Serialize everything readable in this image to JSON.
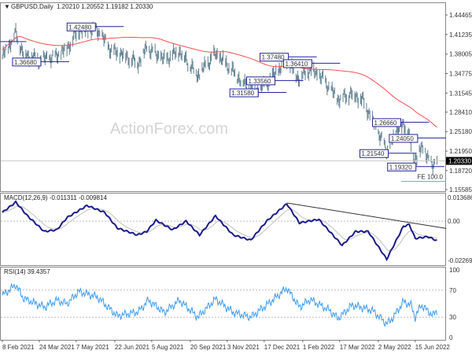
{
  "header": {
    "symbol": "GBPUSD,Daily",
    "ohlc": "1.20210 1.20552 1.19182 1.20330"
  },
  "watermark": "ActionForex.com",
  "colors": {
    "bars": "#5f7f91",
    "ma": "#f05050",
    "macd": "#1a1a8c",
    "signal": "#c0c0c0",
    "rsi": "#3d9bf0",
    "label_border": "#2020a0",
    "current_tag": "#000000"
  },
  "chart_data": [
    {
      "type": "ohlc",
      "title": "GBPUSD,Daily",
      "y_ticks": [
        "1.44465",
        "1.41235",
        "1.38005",
        "1.34775",
        "1.31545",
        "1.28410",
        "1.25180",
        "1.21950",
        "1.18720",
        "1.15585"
      ],
      "ylim": [
        1.15585,
        1.44465
      ],
      "current": "1.20330",
      "current_value": 1.2033,
      "closes": [
        [
          "2021-02-08",
          1.375
        ],
        [
          "2021-02-24",
          1.415
        ],
        [
          "2021-03-05",
          1.38
        ],
        [
          "2021-03-24",
          1.37
        ],
        [
          "2021-04-12",
          1.375
        ],
        [
          "2021-04-26",
          1.39
        ],
        [
          "2021-05-10",
          1.42
        ],
        [
          "2021-06-01",
          1.42
        ],
        [
          "2021-06-18",
          1.385
        ],
        [
          "2021-07-01",
          1.38
        ],
        [
          "2021-07-20",
          1.365
        ],
        [
          "2021-07-30",
          1.39
        ],
        [
          "2021-08-20",
          1.37
        ],
        [
          "2021-09-07",
          1.385
        ],
        [
          "2021-09-29",
          1.345
        ],
        [
          "2021-10-20",
          1.38
        ],
        [
          "2021-11-01",
          1.365
        ],
        [
          "2021-11-24",
          1.33
        ],
        [
          "2021-12-08",
          1.32
        ],
        [
          "2021-12-20",
          1.33
        ],
        [
          "2022-01-13",
          1.37
        ],
        [
          "2022-01-27",
          1.34
        ],
        [
          "2022-02-10",
          1.355
        ],
        [
          "2022-02-24",
          1.34
        ],
        [
          "2022-03-15",
          1.305
        ],
        [
          "2022-03-31",
          1.315
        ],
        [
          "2022-04-13",
          1.305
        ],
        [
          "2022-04-22",
          1.28
        ],
        [
          "2022-05-12",
          1.22
        ],
        [
          "2022-05-27",
          1.262
        ],
        [
          "2022-06-07",
          1.255
        ],
        [
          "2022-06-14",
          1.2
        ],
        [
          "2022-06-20",
          1.225
        ],
        [
          "2022-06-30",
          1.213
        ],
        [
          "2022-07-06",
          1.19
        ],
        [
          "2022-07-11",
          1.2033
        ]
      ],
      "swing_labels": [
        {
          "text": "1.40000",
          "date": "2021-02-01",
          "price": 1.4
        },
        {
          "text": "1.36680",
          "date": "2021-03-24",
          "price": 1.3668
        },
        {
          "text": "1.42480",
          "date": "2021-05-28",
          "price": 1.4248
        },
        {
          "text": "1.31580",
          "date": "2021-12-08",
          "price": 1.3158
        },
        {
          "text": "1.37480",
          "date": "2022-01-13",
          "price": 1.3748
        },
        {
          "text": "1.33560",
          "date": "2021-12-28",
          "price": 1.3356
        },
        {
          "text": "1.36410",
          "date": "2022-02-10",
          "price": 1.3641
        },
        {
          "text": "1.26660",
          "date": "2022-05-27",
          "price": 1.2666
        },
        {
          "text": "1.21540",
          "date": "2022-05-12",
          "price": 1.2154
        },
        {
          "text": "1.24050",
          "date": "2022-06-16",
          "price": 1.2405
        },
        {
          "text": "1.19320",
          "date": "2022-06-14",
          "price": 1.1932
        }
      ],
      "fe_label": "FE 100.0",
      "fe_price": 1.1695
    },
    {
      "type": "line",
      "title": "MACD(12,26,9) -0.011311 -0.009814",
      "y_ticks": [
        "0.013686",
        "0.00",
        "-0.022698"
      ],
      "ylim": [
        -0.022698,
        0.013686
      ],
      "macd": [
        [
          "2021-02-08",
          0.005
        ],
        [
          "2021-02-24",
          0.011
        ],
        [
          "2021-03-10",
          0.003
        ],
        [
          "2021-03-30",
          -0.006
        ],
        [
          "2021-04-14",
          -0.005
        ],
        [
          "2021-04-26",
          0.002
        ],
        [
          "2021-05-20",
          0.009
        ],
        [
          "2021-06-10",
          0.005
        ],
        [
          "2021-06-25",
          -0.004
        ],
        [
          "2021-07-19",
          -0.008
        ],
        [
          "2021-07-30",
          -0.006
        ],
        [
          "2021-08-10",
          0.0005
        ],
        [
          "2021-08-30",
          -0.005
        ],
        [
          "2021-09-15",
          0.0
        ],
        [
          "2021-10-01",
          -0.008
        ],
        [
          "2021-10-20",
          0.003
        ],
        [
          "2021-11-10",
          -0.008
        ],
        [
          "2021-12-01",
          -0.011
        ],
        [
          "2021-12-20",
          0.0
        ],
        [
          "2022-01-13",
          0.01
        ],
        [
          "2022-01-28",
          -0.001
        ],
        [
          "2022-02-20",
          0.001
        ],
        [
          "2022-03-20",
          -0.014
        ],
        [
          "2022-04-05",
          -0.006
        ],
        [
          "2022-04-20",
          -0.006
        ],
        [
          "2022-05-12",
          -0.022
        ],
        [
          "2022-06-01",
          -0.003
        ],
        [
          "2022-06-08",
          -0.002
        ],
        [
          "2022-06-15",
          -0.01
        ],
        [
          "2022-06-30",
          -0.009
        ],
        [
          "2022-07-11",
          -0.0113
        ]
      ],
      "trendline": [
        [
          "2022-01-13",
          0.0105
        ],
        [
          "2022-07-22",
          -0.0042
        ]
      ]
    },
    {
      "type": "line",
      "title": "RSI(14) 39.4357",
      "y_ticks": [
        "100",
        "70",
        "30",
        "0"
      ],
      "ylim": [
        0,
        100
      ],
      "rsi": [
        [
          "2021-02-08",
          62
        ],
        [
          "2021-02-24",
          78
        ],
        [
          "2021-03-05",
          58
        ],
        [
          "2021-03-30",
          45
        ],
        [
          "2021-04-14",
          55
        ],
        [
          "2021-04-26",
          50
        ],
        [
          "2021-05-10",
          68
        ],
        [
          "2021-06-01",
          60
        ],
        [
          "2021-06-25",
          32
        ],
        [
          "2021-07-20",
          38
        ],
        [
          "2021-08-01",
          55
        ],
        [
          "2021-08-20",
          37
        ],
        [
          "2021-09-07",
          55
        ],
        [
          "2021-09-29",
          30
        ],
        [
          "2021-10-20",
          57
        ],
        [
          "2021-11-10",
          37
        ],
        [
          "2021-12-01",
          30
        ],
        [
          "2021-12-20",
          48
        ],
        [
          "2022-01-13",
          73
        ],
        [
          "2022-01-28",
          45
        ],
        [
          "2022-02-10",
          56
        ],
        [
          "2022-03-05",
          40
        ],
        [
          "2022-03-15",
          28
        ],
        [
          "2022-04-01",
          48
        ],
        [
          "2022-04-25",
          40
        ],
        [
          "2022-05-12",
          20
        ],
        [
          "2022-05-20",
          30
        ],
        [
          "2022-06-01",
          53
        ],
        [
          "2022-06-10",
          48
        ],
        [
          "2022-06-15",
          30
        ],
        [
          "2022-06-22",
          48
        ],
        [
          "2022-07-06",
          33
        ],
        [
          "2022-07-11",
          39.4357
        ]
      ]
    }
  ],
  "x_ticks": [
    [
      "8 Feb 2021",
      "2021-02-08"
    ],
    [
      "24 Mar 2021",
      "2021-03-24"
    ],
    [
      "7 May 2021",
      "2021-05-07"
    ],
    [
      "22 Jun 2021",
      "2021-06-22"
    ],
    [
      "5 Aug 2021",
      "2021-08-05"
    ],
    [
      "20 Sep 2021",
      "2021-09-20"
    ],
    [
      "3 Nov 2021",
      "2021-11-03"
    ],
    [
      "17 Dec 2021",
      "2021-12-17"
    ],
    [
      "1 Feb 2022",
      "2022-02-01"
    ],
    [
      "17 Mar 2022",
      "2022-03-17"
    ],
    [
      "2 May 2022",
      "2022-05-02"
    ],
    [
      "15 Jun 2022",
      "2022-06-15"
    ]
  ]
}
